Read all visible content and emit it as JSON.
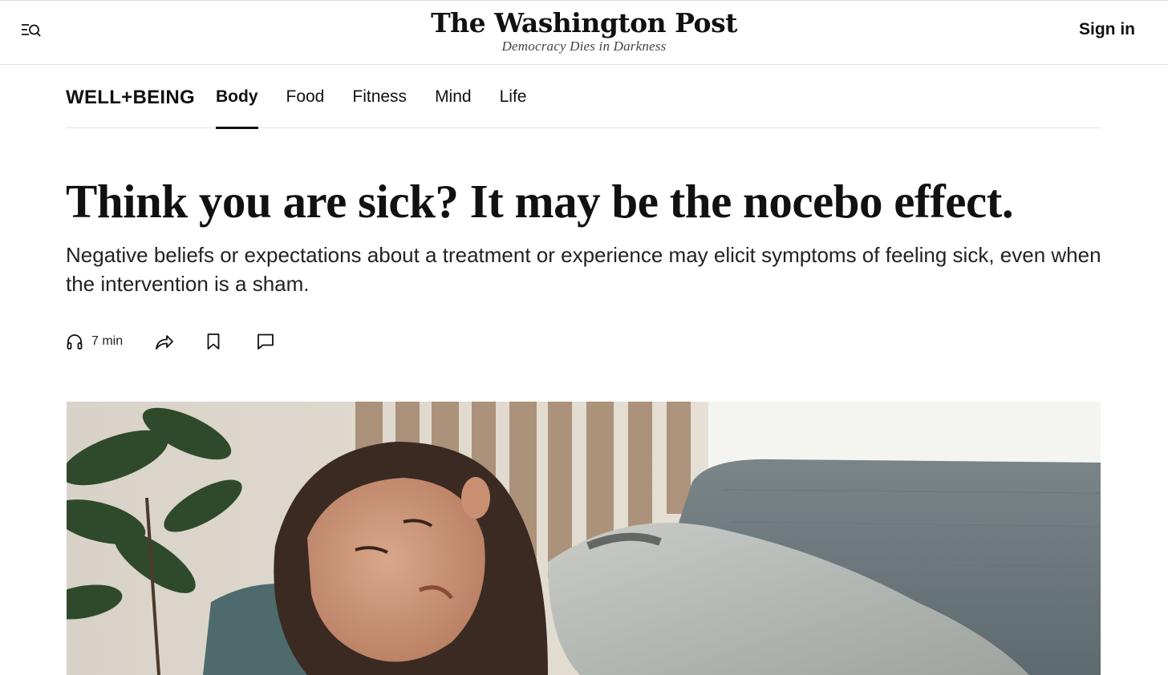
{
  "header": {
    "menu_icon": "menu-search-icon",
    "logo": "The Washington Post",
    "tagline": "Democracy Dies in Darkness",
    "signin_label": "Sign in"
  },
  "subnav": {
    "section": "WELL+BEING",
    "tabs": [
      {
        "label": "Body",
        "active": true
      },
      {
        "label": "Food",
        "active": false
      },
      {
        "label": "Fitness",
        "active": false
      },
      {
        "label": "Mind",
        "active": false
      },
      {
        "label": "Life",
        "active": false
      }
    ]
  },
  "article": {
    "headline": "Think you are sick? It may be the nocebo effect.",
    "dek": "Negative beliefs or expectations about a treatment or experience may elicit symptoms of feeling sick, even when the intervention is a sham.",
    "actions": {
      "listen_icon": "headphones-icon",
      "listen_label": "7 min",
      "share_icon": "share-icon",
      "save_icon": "bookmark-icon",
      "comment_icon": "comment-icon"
    },
    "hero_image": "woman-resting-on-couch-under-blanket"
  }
}
